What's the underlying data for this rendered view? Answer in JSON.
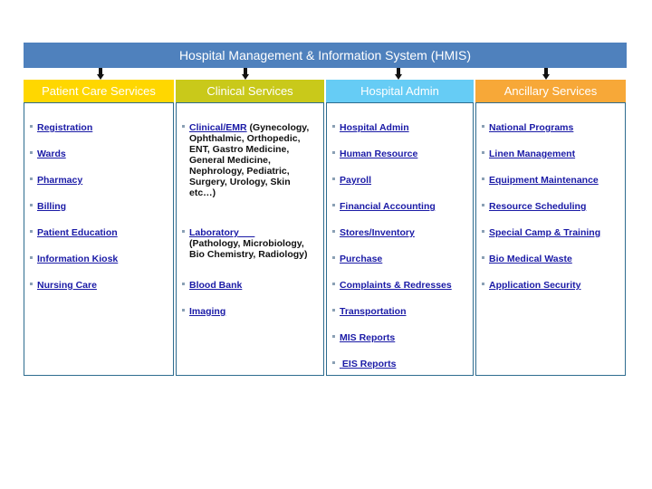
{
  "title": "Hospital Management & Information System (HMIS)",
  "colors": {
    "title_bar": "#4f81bd",
    "patient_care": "#ffd700",
    "clinical": "#c9c91a",
    "hospital_admin": "#66ccf5",
    "ancillary": "#f7a838",
    "link": "#1a1aa6",
    "border": "#2e6c8f"
  },
  "columns": [
    {
      "header": "Patient Care Services",
      "items": [
        {
          "label": "Registration"
        },
        {
          "label": "Wards"
        },
        {
          "label": "Pharmacy"
        },
        {
          "label": "Billing"
        },
        {
          "label": "Patient Education"
        },
        {
          "label": "Information Kiosk"
        },
        {
          "label": "Nursing Care"
        }
      ]
    },
    {
      "header": "Clinical Services",
      "items": [
        {
          "label": "Clinical/EMR",
          "desc_first": " (Gynecology,",
          "desc_rest": "Ophthalmic, Orthopedic, ENT, Gastro Medicine, General Medicine, Nephrology, Pediatric, Surgery, Urology, Skin etc…)"
        },
        {
          "label": "Laboratory",
          "desc_rest": "(Pathology, Microbiology, Bio Chemistry, Radiology)"
        },
        {
          "label": "Blood Bank"
        },
        {
          "label": "Imaging"
        }
      ]
    },
    {
      "header": "Hospital Admin",
      "items": [
        {
          "label": "Hospital Admin"
        },
        {
          "label": "Human Resource"
        },
        {
          "label": "Payroll"
        },
        {
          "label": "Financial Accounting"
        },
        {
          "label": "Stores/Inventory"
        },
        {
          "label": "Purchase"
        },
        {
          "label": "Complaints & Redresses"
        },
        {
          "label": "Transportation"
        },
        {
          "label": "MIS Reports"
        },
        {
          "label": "EIS Reports"
        }
      ]
    },
    {
      "header": "Ancillary Services",
      "items": [
        {
          "label": "National Programs"
        },
        {
          "label": "Linen Management"
        },
        {
          "label": "Equipment Maintenance"
        },
        {
          "label": "Resource Scheduling"
        },
        {
          "label": "Special Camp & Training"
        },
        {
          "label": "Bio Medical Waste"
        },
        {
          "label": "Application Security"
        }
      ]
    }
  ]
}
